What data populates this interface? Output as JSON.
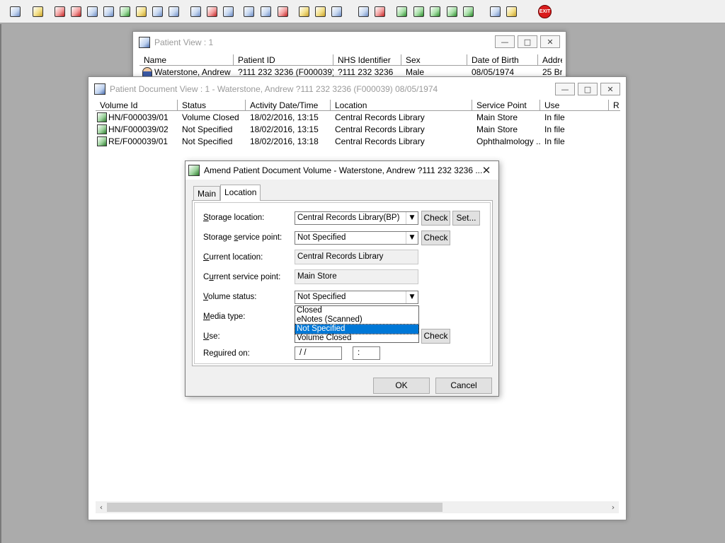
{
  "toolbar": {
    "icons": [
      "patient-find-icon",
      "print-icon",
      "case-notes-icon",
      "edit-notes-icon",
      "document-view-icon",
      "mail-icon",
      "doctor-icon",
      "referral-icon",
      "transport-icon",
      "vehicle-icon",
      "search-volume-icon",
      "clock-icon",
      "monitor-icon",
      "patient-card-icon",
      "report-icon",
      "chart-pie-icon",
      "note-icon",
      "bed-icon",
      "doctor-list-icon",
      "document-icon",
      "bar-chart-icon",
      "tracking-icon",
      "volume-request-icon",
      "volume-return-icon",
      "volume-transfer-icon",
      "volume-receive-icon",
      "undo-icon",
      "warning-icon"
    ],
    "exit_label": "EXIT"
  },
  "patient_view": {
    "title": "Patient View : 1",
    "columns": [
      "Name",
      "Patient ID",
      "NHS Identifier",
      "Sex",
      "Date of Birth",
      "Addre"
    ],
    "row": [
      "Waterstone, Andrew",
      "?111 232 3236 (F000039)",
      "?111 232 3236",
      "Male",
      "08/05/1974",
      "25 Br"
    ]
  },
  "document_view": {
    "title": "Patient Document View : 1 - Waterstone, Andrew ?111 232 3236 (F000039) 08/05/1974",
    "columns": [
      "Volume Id",
      "Status",
      "Activity Date/Time",
      "Location",
      "Service Point",
      "Use",
      "R"
    ],
    "rows": [
      [
        "HN/F000039/01",
        "Volume Closed",
        "18/02/2016, 13:15",
        "Central Records Library",
        "Main Store",
        "In file"
      ],
      [
        "HN/F000039/02",
        "Not Specified",
        "18/02/2016, 13:15",
        "Central Records Library",
        "Main Store",
        "In file"
      ],
      [
        "RE/F000039/01",
        "Not Specified",
        "18/02/2016, 13:18",
        "Central Records Library",
        "Ophthalmology ...",
        "In file"
      ]
    ]
  },
  "dialog": {
    "title": "Amend Patient Document Volume - Waterstone, Andrew ?111 232 3236 ...",
    "tabs": [
      "Main",
      "Location"
    ],
    "storage_location_label_u": "S",
    "storage_location_label_rest": "torage location:",
    "storage_location_value": "Central Records Library(BP)",
    "storage_sp_label_a": "Storage ",
    "storage_sp_label_u": "s",
    "storage_sp_label_rest": "ervice point:",
    "storage_sp_value": "Not Specified",
    "current_location_label_u": "C",
    "current_location_label_rest": "urrent location:",
    "current_location_value": "Central Records Library",
    "current_sp_label_a": "C",
    "current_sp_label_u": "u",
    "current_sp_label_rest": "rrent service point:",
    "current_sp_value": "Main Store",
    "volume_status_label_u": "V",
    "volume_status_label_rest": "olume status:",
    "volume_status_value": "Not Specified",
    "volume_status_options": [
      "Closed",
      "eNotes (Scanned)",
      "Not Specified",
      "Volume Closed"
    ],
    "media_type_label_u": "M",
    "media_type_label_rest": "edia type:",
    "use_label_u": "U",
    "use_label_rest": "se:",
    "required_on_label_a": "Re",
    "required_on_label_u": "q",
    "required_on_label_rest": "uired on:",
    "required_date": "/  /",
    "required_time": ":",
    "check_label": "Check",
    "set_label": "Set...",
    "ok_label": "OK",
    "cancel_label": "Cancel"
  }
}
